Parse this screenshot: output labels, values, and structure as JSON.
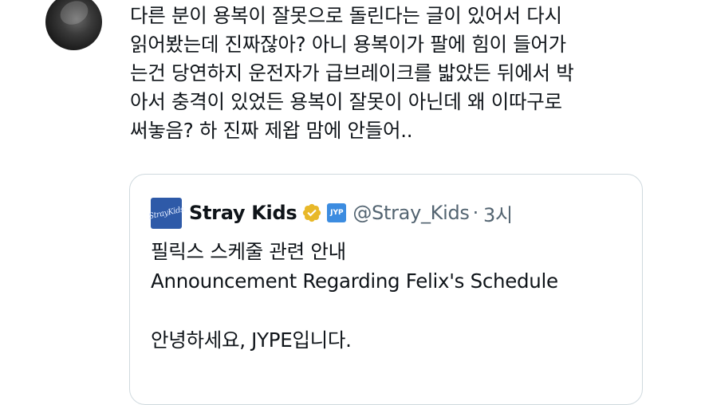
{
  "tweet": {
    "text_lines": [
      "다른 분이 용복이 잘못으로 돌린다는 글이 있어서 다시",
      "읽어봤는데 진짜잖아? 아니 용복이가 팔에 힘이 들어가",
      "는건 당연하지 운전자가 급브레이크를 밟았든 뒤에서 박",
      "아서 충격이 있었든 용복이 잘못이 아닌데 왜 이따구로",
      "써놓음? 하 진짜 제왑 맘에 안들어.."
    ]
  },
  "quote": {
    "logo_text": "StrayKids",
    "author_name": "Stray Kids",
    "affiliate_badge": "JYP",
    "handle": "@Stray_Kids",
    "separator": "·",
    "time": "3시",
    "body_lines": [
      "필릭스 스케줄 관련 안내",
      "Announcement Regarding Felix's Schedule",
      "",
      "안녕하세요, JYPE입니다."
    ]
  },
  "colors": {
    "text": "#0f1419",
    "secondary_text": "#536471",
    "border": "#cfd9de",
    "verified_gold": "#e8b829",
    "affiliate_blue": "#3c8ce0"
  }
}
